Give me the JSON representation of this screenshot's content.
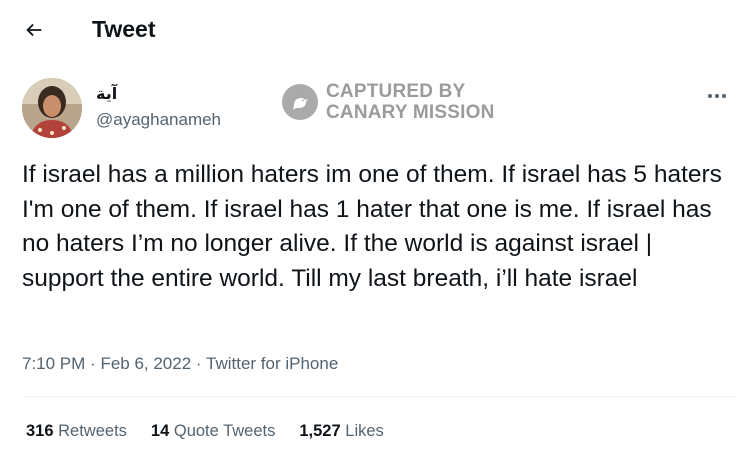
{
  "header": {
    "back_icon": "arrow-left-icon",
    "title": "Tweet"
  },
  "tweet": {
    "author": {
      "display_name": "آية",
      "handle": "@ayaghanameh"
    },
    "more_icon": "ellipsis-icon",
    "text": "If israel has a million haters im one of them. If israel has 5 haters I'm one of them. If israel has 1 hater that one is me. If israel has no haters I’m no longer alive. If the world is against israel | support the entire world. Till my last breath, i’ll hate israel",
    "time": "7:10 PM",
    "date": "Feb 6, 2022",
    "source": "Twitter for iPhone",
    "stats": {
      "retweets_count": "316",
      "retweets_label": "Retweets",
      "quotes_count": "14",
      "quotes_label": "Quote Tweets",
      "likes_count": "1,527",
      "likes_label": "Likes"
    }
  },
  "watermark": {
    "line1": "CAPTURED BY",
    "line2": "CANARY MISSION",
    "icon": "canary-bird-icon"
  },
  "colors": {
    "text_primary": "#0f1419",
    "text_secondary": "#536471",
    "divider": "#eff3f4",
    "watermark": "#7a7a7a"
  }
}
